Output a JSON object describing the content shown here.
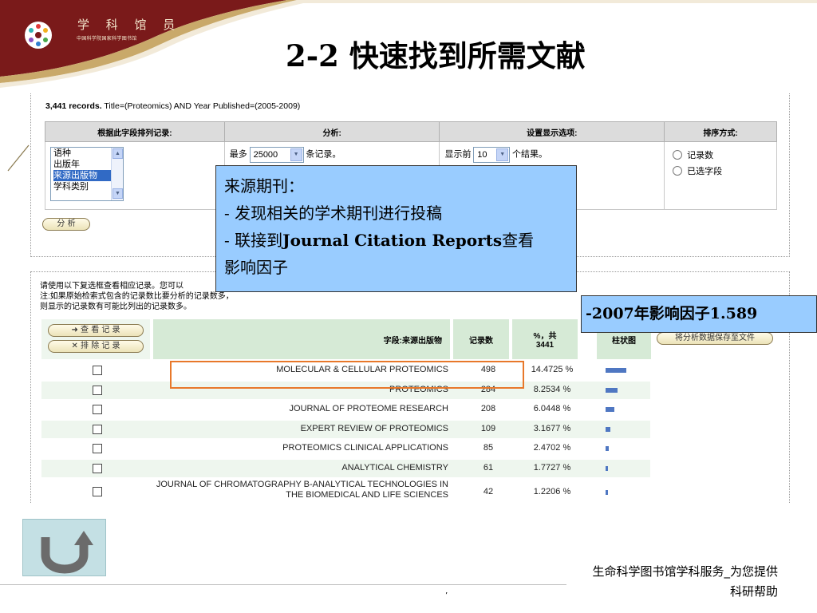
{
  "header": {
    "logo_main": "学 科 馆 员",
    "logo_sub": "中国科学院国家科学图书馆",
    "title": "2-2 快速找到所需文献"
  },
  "analysis": {
    "records_count": "3,441 records.",
    "records_query": "Title=(Proteomics) AND Year Published=(2005-2009)",
    "columns": [
      "根据此字段排列记录:",
      "分析:",
      "设置显示选项:",
      "排序方式:"
    ],
    "field_options": [
      "语种",
      "出版年",
      "来源出版物",
      "学科类别"
    ],
    "field_selected": "来源出版物",
    "max_prefix": "最多",
    "max_value": "25000",
    "max_suffix": "条记录。",
    "show_prefix": "显示前",
    "show_value": "10",
    "show_suffix": "个结果。",
    "sort_options": [
      "记录数",
      "已选字段"
    ],
    "analyze_button": "分 析"
  },
  "callout": {
    "line1": "来源期刊：",
    "line2": "- 发现相关的学术期刊进行投稿",
    "line3_prefix": "- 联接到",
    "line3_bold": "Journal Citation Reports",
    "line3_suffix": "查看",
    "line4": "影响因子"
  },
  "impact": {
    "text": "-2007年影响因子1.589"
  },
  "instructions": {
    "line1": "请使用以下复选框查看相应记录。您可以",
    "line2": "注:如果原始检索式包含的记录数比要分析的记录数多，",
    "line3": "则显示的记录数有可能比列出的记录数多。"
  },
  "results": {
    "view_button": "➜ 查 看 记 录",
    "exclude_button": "✕ 排 除 记 录",
    "col_field": "字段:来源出版物",
    "col_count": "记录数",
    "col_pct_line1": "%，共",
    "col_pct_line2": "3441",
    "col_bar": "柱状图",
    "save_button": "将分析数据保存至文件",
    "rows": [
      {
        "name": "MOLECULAR & CELLULAR PROTEOMICS",
        "count": "498",
        "pct": "14.4725 %",
        "share": 14.4725
      },
      {
        "name": "PROTEOMICS",
        "count": "284",
        "pct": "8.2534 %",
        "share": 8.2534
      },
      {
        "name": "JOURNAL OF PROTEOME RESEARCH",
        "count": "208",
        "pct": "6.0448 %",
        "share": 6.0448
      },
      {
        "name": "EXPERT REVIEW OF PROTEOMICS",
        "count": "109",
        "pct": "3.1677 %",
        "share": 3.1677
      },
      {
        "name": "PROTEOMICS CLINICAL APPLICATIONS",
        "count": "85",
        "pct": "2.4702 %",
        "share": 2.4702
      },
      {
        "name": "ANALYTICAL CHEMISTRY",
        "count": "61",
        "pct": "1.7727 %",
        "share": 1.7727
      },
      {
        "name": "JOURNAL OF CHROMATOGRAPHY B-ANALYTICAL TECHNOLOGIES IN THE BIOMEDICAL AND LIFE SCIENCES",
        "count": "42",
        "pct": "1.2206 %",
        "share": 1.2206
      }
    ]
  },
  "footer": {
    "line1": "生命科学图书馆学科服务_为您提供",
    "line2": "科研帮助",
    "page_mark": "’"
  },
  "colors": {
    "header_brown": "#6b1414",
    "header_tan": "#c9a96a",
    "callout_blue": "#99ccff",
    "highlight_orange": "#e8782a",
    "bar_blue": "#4f77c2"
  }
}
